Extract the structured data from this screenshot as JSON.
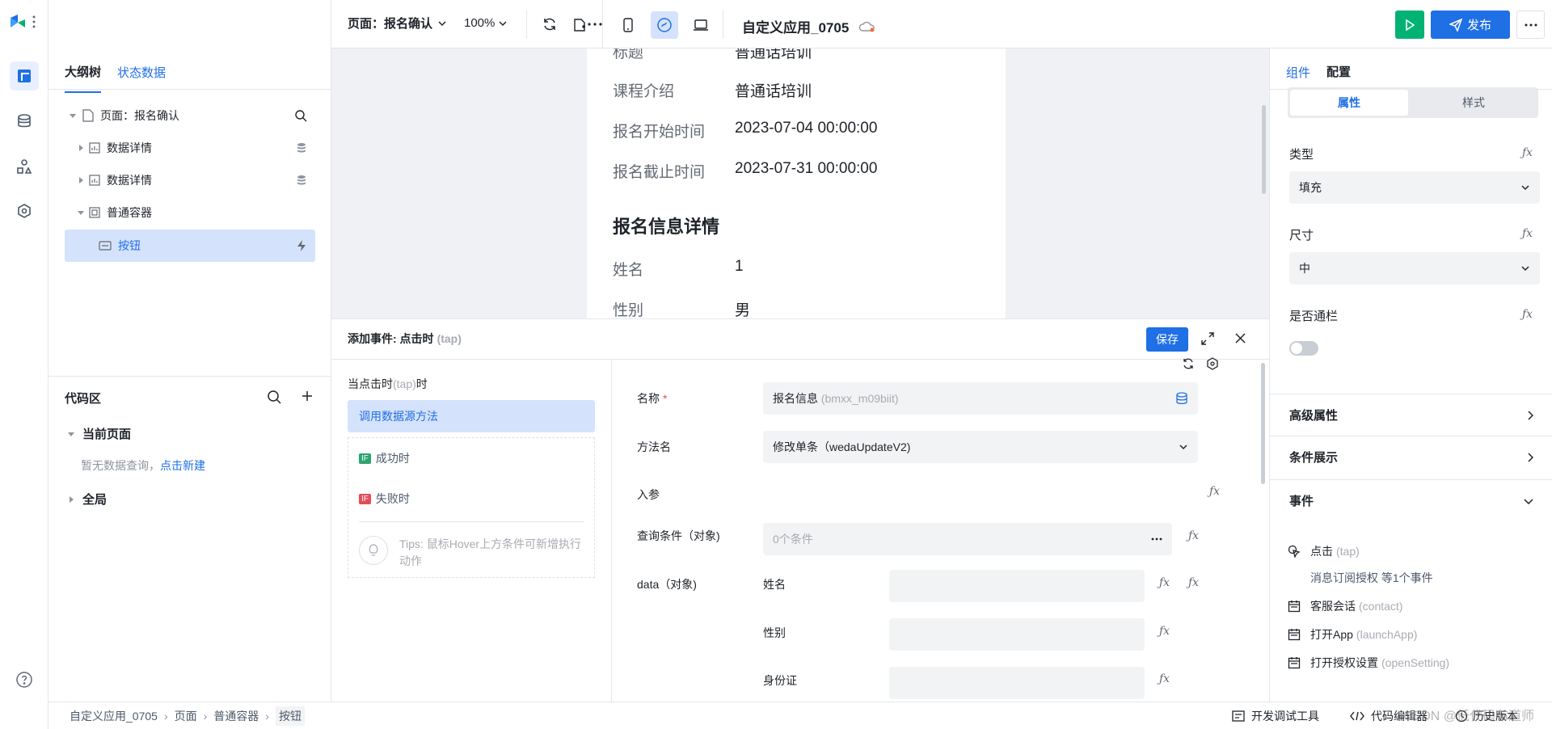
{
  "toolbar": {
    "page_selector": "页面：报名确认",
    "zoom": "100%",
    "app_title": "自定义应用_0705",
    "publish_label": "发布"
  },
  "left_tabs": [
    "大纲树",
    "状态数据"
  ],
  "tree": {
    "root": "页面：报名确认",
    "items": [
      "数据详情",
      "数据详情",
      "普通容器",
      "按钮"
    ]
  },
  "code": {
    "title": "代码区",
    "current_page": "当前页面",
    "empty_text": "暂无数据查询，",
    "new_link": "点击新建",
    "global": "全局"
  },
  "preview": {
    "partial_label": "标题",
    "partial_value": "普通话培训",
    "rows": [
      {
        "label": "课程介绍",
        "value": "普通话培训"
      },
      {
        "label": "报名开始时间",
        "value": "2023-07-04 00:00:00"
      },
      {
        "label": "报名截止时间",
        "value": "2023-07-31 00:00:00"
      }
    ],
    "section_title": "报名信息详情",
    "rows2": [
      {
        "label": "姓名",
        "value": "1"
      },
      {
        "label": "性别",
        "value": "男"
      }
    ]
  },
  "event": {
    "title_prefix": "添加事件: 点击时",
    "title_tag": "(tap)",
    "save_label": "保存",
    "trigger_prefix": "当点击时",
    "trigger_tag": "(tap)",
    "trigger_suffix": "时",
    "action": "调用数据源方法",
    "success_badge": "IF",
    "success": "成功时",
    "fail_badge": "IF",
    "fail": "失败时",
    "tips": "Tips: 鼠标Hover上方条件可新增执行动作",
    "name_label": "名称",
    "required_mark": "*",
    "name_value": "报名信息",
    "name_code": "(bmxx_m09biit)",
    "method_label": "方法名",
    "method_value": "修改单条（wedaUpdateV2)",
    "params_label": "入参",
    "query_label": "查询条件（对象)",
    "query_value": "0个条件",
    "data_label": "data（对象)",
    "data_fields": [
      "姓名",
      "性别",
      "身份证"
    ]
  },
  "right": {
    "tabs": [
      "组件",
      "配置"
    ],
    "seg": [
      "属性",
      "样式"
    ],
    "type_label": "类型",
    "type_value": "填充",
    "size_label": "尺寸",
    "size_value": "中",
    "banner_label": "是否通栏",
    "advanced": "高级属性",
    "conditional": "条件展示",
    "events": "事件",
    "event_items": [
      {
        "label": "点击",
        "tag": "(tap)"
      },
      {
        "label": "消息订阅授权 等1个事件",
        "tag": ""
      },
      {
        "label": "客服会话",
        "tag": "(contact)"
      },
      {
        "label": "打开App",
        "tag": "(launchApp)"
      },
      {
        "label": "打开授权设置",
        "tag": "(openSetting)"
      }
    ]
  },
  "status": {
    "breadcrumb": [
      "自定义应用_0705",
      "页面",
      "普通容器",
      "按钮"
    ],
    "debug_tool": "开发调试工具",
    "code_editor": "代码编辑器",
    "version": "历史版本",
    "watermark": "CSDN @低代码布道师"
  },
  "colors": {
    "primary": "#1f6fe5",
    "run": "#00b374",
    "selected_bg": "#d5e2fb",
    "success_badge": "#2ba471",
    "fail_badge": "#e34d59"
  }
}
